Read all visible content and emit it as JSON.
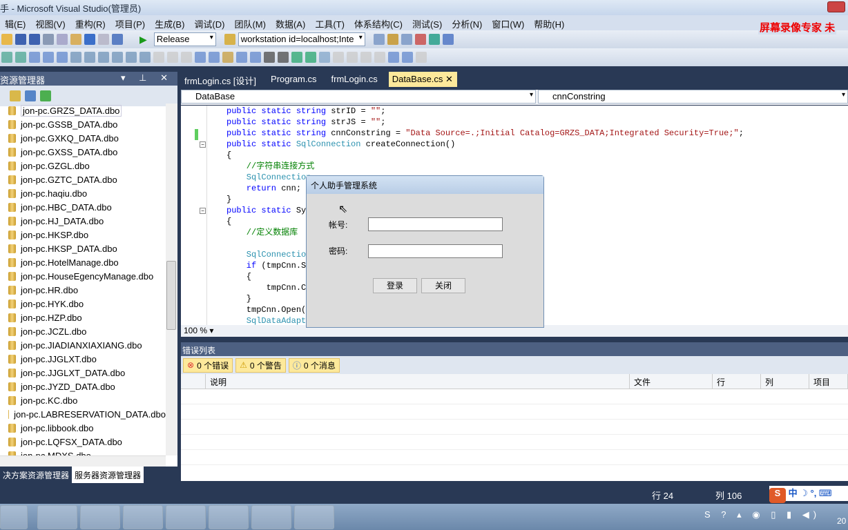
{
  "window": {
    "title": "手 - Microsoft Visual Studio(管理员)",
    "recorder_watermark": "屏幕录像专家  未"
  },
  "menu": [
    "辑(E)",
    "视图(V)",
    "重构(R)",
    "项目(P)",
    "生成(B)",
    "调试(D)",
    "团队(M)",
    "数据(A)",
    "工具(T)",
    "体系结构(C)",
    "测试(S)",
    "分析(N)",
    "窗口(W)",
    "帮助(H)"
  ],
  "toolbar": {
    "config": "Release",
    "connection": "workstation id=localhost;Inte"
  },
  "left_panel": {
    "title": "资源管理器",
    "items": [
      "jon-pc.GRZS_DATA.dbo",
      "jon-pc.GSSB_DATA.dbo",
      "jon-pc.GXKQ_DATA.dbo",
      "jon-pc.GXSS_DATA.dbo",
      "jon-pc.GZGL.dbo",
      "jon-pc.GZTC_DATA.dbo",
      "jon-pc.haqiu.dbo",
      "jon-pc.HBC_DATA.dbo",
      "jon-pc.HJ_DATA.dbo",
      "jon-pc.HKSP.dbo",
      "jon-pc.HKSP_DATA.dbo",
      "jon-pc.HotelManage.dbo",
      "jon-pc.HouseEgencyManage.dbo",
      "jon-pc.HR.dbo",
      "jon-pc.HYK.dbo",
      "jon-pc.HZP.dbo",
      "jon-pc.JCZL.dbo",
      "jon-pc.JIADIANXIAXIANG.dbo",
      "jon-pc.JJGLXT.dbo",
      "jon-pc.JJGLXT_DATA.dbo",
      "jon-pc.JYZD_DATA.dbo",
      "jon-pc.KC.dbo",
      "jon-pc.LABRESERVATION_DATA.dbo",
      "jon-pc.libbook.dbo",
      "jon-pc.LQFSX_DATA.dbo",
      "jon-pc.MDXS.dbo"
    ],
    "tabs": [
      "决方案资源管理器",
      "服务器资源管理器"
    ]
  },
  "doc_tabs": [
    "frmLogin.cs [设计]",
    "Program.cs",
    "frmLogin.cs",
    "DataBase.cs"
  ],
  "nav": {
    "class": "DataBase",
    "member": "cnnConstring"
  },
  "code": [
    [
      [
        "kw",
        "public static string "
      ],
      [
        "",
        "strID = "
      ],
      [
        "str",
        "\"\""
      ],
      [
        "",
        ";"
      ]
    ],
    [
      [
        "kw",
        "public static string "
      ],
      [
        "",
        "strJS = "
      ],
      [
        "str",
        "\"\""
      ],
      [
        "",
        ";"
      ]
    ],
    [
      [
        "kw",
        "public static string "
      ],
      [
        "",
        "cnnConstring = "
      ],
      [
        "str",
        "\"Data Source=.;Initial Catalog=GRZS_DATA;Integrated Security=True;\""
      ],
      [
        "",
        ";"
      ]
    ],
    [
      [
        "kw",
        "public static "
      ],
      [
        "ty",
        "SqlConnection"
      ],
      [
        "",
        " createConnection()"
      ]
    ],
    [
      [
        "",
        "{"
      ]
    ],
    [
      [
        "cm",
        "    //字符串连接方式"
      ]
    ],
    [
      [
        "ty",
        "    SqlConnection"
      ]
    ],
    [
      [
        "kw",
        "    return "
      ],
      [
        "",
        "cnn;"
      ]
    ],
    [
      [
        "",
        "}"
      ]
    ],
    [
      [
        "kw",
        "public static "
      ],
      [
        "",
        "Sy"
      ]
    ],
    [
      [
        "",
        "{"
      ]
    ],
    [
      [
        "cm",
        "    //定义数据库"
      ]
    ],
    [
      [
        "",
        ""
      ]
    ],
    [
      [
        "ty",
        "    SqlConnection"
      ]
    ],
    [
      [
        "kw",
        "    if "
      ],
      [
        "",
        "(tmpCnn.S"
      ]
    ],
    [
      [
        "",
        "    {"
      ]
    ],
    [
      [
        "",
        "        tmpCnn.C"
      ]
    ],
    [
      [
        "",
        "    }"
      ]
    ],
    [
      [
        "",
        "    tmpCnn.Open()"
      ]
    ],
    [
      [
        "ty",
        "    SqlDataAdapt"
      ]
    ]
  ],
  "zoom": "100 %",
  "dialog": {
    "title": "个人助手管理系统",
    "account_label": "帐号:",
    "password_label": "密码:",
    "account_value": "",
    "password_value": "",
    "login": "登录",
    "close": "关闭"
  },
  "error_list": {
    "title": "错误列表",
    "errors": "0 个错误",
    "warnings": "0 个警告",
    "messages": "0 个消息",
    "columns": [
      "说明",
      "文件",
      "行",
      "列",
      "项目"
    ]
  },
  "status": {
    "line": "行 24",
    "col": "列 106"
  },
  "taskbar": {
    "clock": "20"
  }
}
